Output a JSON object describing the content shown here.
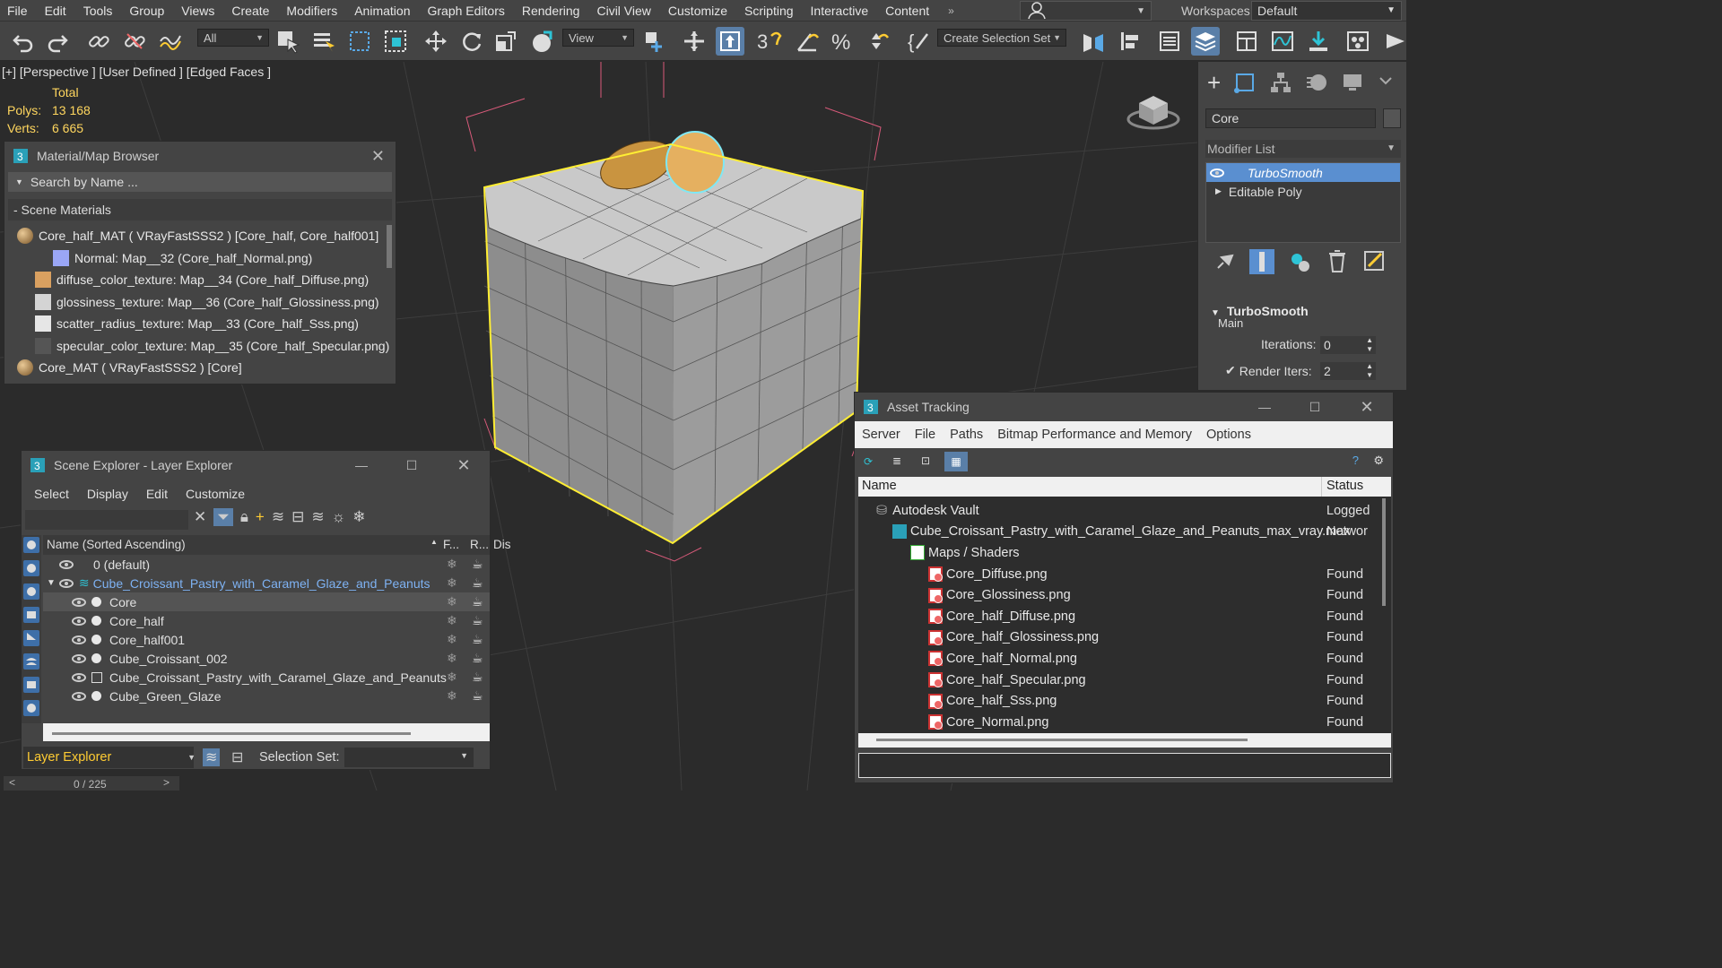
{
  "menubar": {
    "items": [
      "File",
      "Edit",
      "Tools",
      "Group",
      "Views",
      "Create",
      "Modifiers",
      "Animation",
      "Graph Editors",
      "Rendering",
      "Civil View",
      "Customize",
      "Scripting",
      "Interactive",
      "Content"
    ],
    "more": "»",
    "workspaces_label": "Workspaces:",
    "workspace_value": "Default"
  },
  "toolbar": {
    "filter_value": "All",
    "view_value": "View",
    "selection_set_value": "Create Selection Set"
  },
  "viewport": {
    "label": "[+] [Perspective ] [User Defined ] [Edged Faces ]",
    "stats_header": "Total",
    "polys_label": "Polys:",
    "polys_value": "13 168",
    "verts_label": "Verts:",
    "verts_value": "6 665"
  },
  "material_browser": {
    "title": "Material/Map Browser",
    "search_placeholder": "Search by Name ...",
    "section": "- Scene Materials",
    "items": [
      {
        "label": "Core_half_MAT  ( VRayFastSSS2 )  [Core_half, Core_half001]"
      },
      {
        "label": "Normal: Map__32 (Core_half_Normal.png)"
      },
      {
        "label": "diffuse_color_texture: Map__34 (Core_half_Diffuse.png)"
      },
      {
        "label": "glossiness_texture: Map__36 (Core_half_Glossiness.png)"
      },
      {
        "label": "scatter_radius_texture: Map__33 (Core_half_Sss.png)"
      },
      {
        "label": "specular_color_texture: Map__35 (Core_half_Specular.png)"
      },
      {
        "label": "Core_MAT  ( VRayFastSSS2 )  [Core]"
      }
    ]
  },
  "scene_explorer": {
    "title": "Scene Explorer - Layer Explorer",
    "menu": [
      "Select",
      "Display",
      "Edit",
      "Customize"
    ],
    "col_name": "Name (Sorted Ascending)",
    "col_f": "F...",
    "col_r": "R...",
    "col_dis": "Dis",
    "rows": [
      {
        "label": "0 (default)"
      },
      {
        "label": "Cube_Croissant_Pastry_with_Caramel_Glaze_and_Peanuts"
      },
      {
        "label": "Core"
      },
      {
        "label": "Core_half"
      },
      {
        "label": "Core_half001"
      },
      {
        "label": "Cube_Croissant_002"
      },
      {
        "label": "Cube_Croissant_Pastry_with_Caramel_Glaze_and_Peanuts"
      },
      {
        "label": "Cube_Green_Glaze"
      }
    ],
    "footer_mode": "Layer Explorer",
    "selection_set_label": "Selection Set:"
  },
  "command_panel": {
    "object_name": "Core",
    "modifier_list": "Modifier List",
    "modifiers": [
      "TurboSmooth",
      "Editable Poly"
    ],
    "rollout_title": "TurboSmooth",
    "group_main": "Main",
    "iterations_label": "Iterations:",
    "iterations_value": "0",
    "render_iters_label": "Render Iters:",
    "render_iters_value": "2"
  },
  "asset_tracking": {
    "title": "Asset Tracking",
    "menu": [
      "Server",
      "File",
      "Paths",
      "Bitmap Performance and Memory",
      "Options"
    ],
    "col_name": "Name",
    "col_status": "Status",
    "rows": [
      {
        "name": "Autodesk Vault",
        "status": "Logged"
      },
      {
        "name": "Cube_Croissant_Pastry_with_Caramel_Glaze_and_Peanuts_max_vray.max",
        "status": "Networ"
      },
      {
        "name": "Maps / Shaders",
        "status": ""
      },
      {
        "name": "Core_Diffuse.png",
        "status": "Found"
      },
      {
        "name": "Core_Glossiness.png",
        "status": "Found"
      },
      {
        "name": "Core_half_Diffuse.png",
        "status": "Found"
      },
      {
        "name": "Core_half_Glossiness.png",
        "status": "Found"
      },
      {
        "name": "Core_half_Normal.png",
        "status": "Found"
      },
      {
        "name": "Core_half_Specular.png",
        "status": "Found"
      },
      {
        "name": "Core_half_Sss.png",
        "status": "Found"
      },
      {
        "name": "Core_Normal.png",
        "status": "Found"
      }
    ]
  },
  "timeline": {
    "frame": "0 / 225",
    "prev": "<",
    "next": ">"
  }
}
